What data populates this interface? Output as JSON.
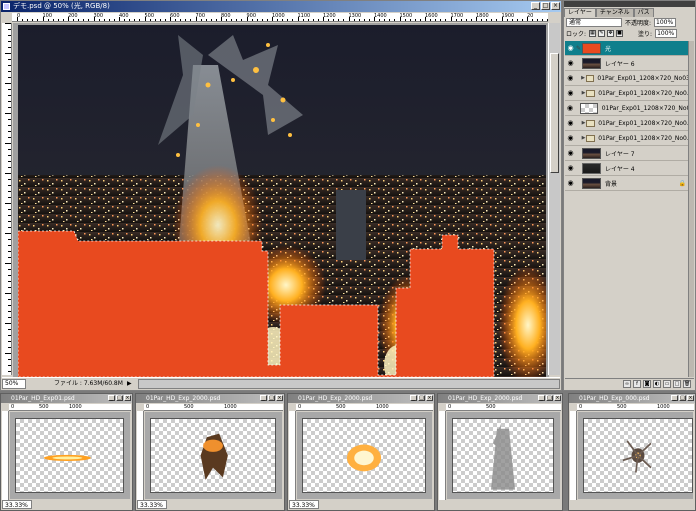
{
  "main_window": {
    "title": "デモ.psd @ 50% (光, RGB/8)",
    "ruler_h": [
      "0",
      "100",
      "200",
      "300",
      "400",
      "500",
      "600",
      "700",
      "800",
      "900",
      "1000",
      "1100",
      "1200",
      "1300",
      "1400",
      "1500",
      "1600",
      "1700",
      "1800",
      "1900",
      "20"
    ],
    "zoom": "50%",
    "file_info": "ファイル : 7.63M/60.8M",
    "status_arrow": "▶"
  },
  "layers_panel": {
    "tabs": [
      "レイヤー",
      "チャンネル",
      "パス"
    ],
    "blend_mode": "通常",
    "opacity_label": "不透明度:",
    "opacity_value": "100%",
    "lock_label": "ロック:",
    "fill_label": "塗り:",
    "fill_value": "100%",
    "layers": [
      {
        "name": "光",
        "thumb": "orange",
        "selected": true,
        "group": false
      },
      {
        "name": "レイヤー 6",
        "thumb": "city",
        "selected": false,
        "group": false
      },
      {
        "name": "01Par_Exp01_1208×720_No03...",
        "thumb": "folder",
        "selected": false,
        "group": true
      },
      {
        "name": "01Par_Exp01_1208×720_No0...",
        "thumb": "folder",
        "selected": false,
        "group": true
      },
      {
        "name": "01Par_Exp01_1208×720_No03...",
        "thumb": "checker",
        "selected": false,
        "group": false
      },
      {
        "name": "01Par_Exp01_1208×720_No0...",
        "thumb": "folder",
        "selected": false,
        "group": true
      },
      {
        "name": "01Par_Exp01_1208×720_No0...",
        "thumb": "folder",
        "selected": false,
        "group": true
      },
      {
        "name": "レイヤー 7",
        "thumb": "city",
        "selected": false,
        "group": false
      },
      {
        "name": "レイヤー 4",
        "thumb": "dark",
        "selected": false,
        "group": false
      },
      {
        "name": "背景",
        "thumb": "city",
        "selected": false,
        "group": false,
        "locked": true
      }
    ]
  },
  "sub_windows": [
    {
      "title": "01Par_HD_Exp01.psd",
      "zoom": "33.33%"
    },
    {
      "title": "01Par_HD_Exp_2000.psd",
      "zoom": "33.33%"
    },
    {
      "title": "01Par_HD_Exp_2000.psd",
      "zoom": "33.33%"
    },
    {
      "title": "01Par_HD_Exp_2000.psd",
      "zoom": ""
    },
    {
      "title": "01Par_HD_Exp_000.psd",
      "zoom": ""
    }
  ],
  "colors": {
    "overlay_orange": "#e84a1f",
    "selected_layer": "#0f7f8c"
  },
  "icons": {
    "eye": "eye-icon",
    "lock": "lock-icon",
    "folder": "folder-icon"
  }
}
